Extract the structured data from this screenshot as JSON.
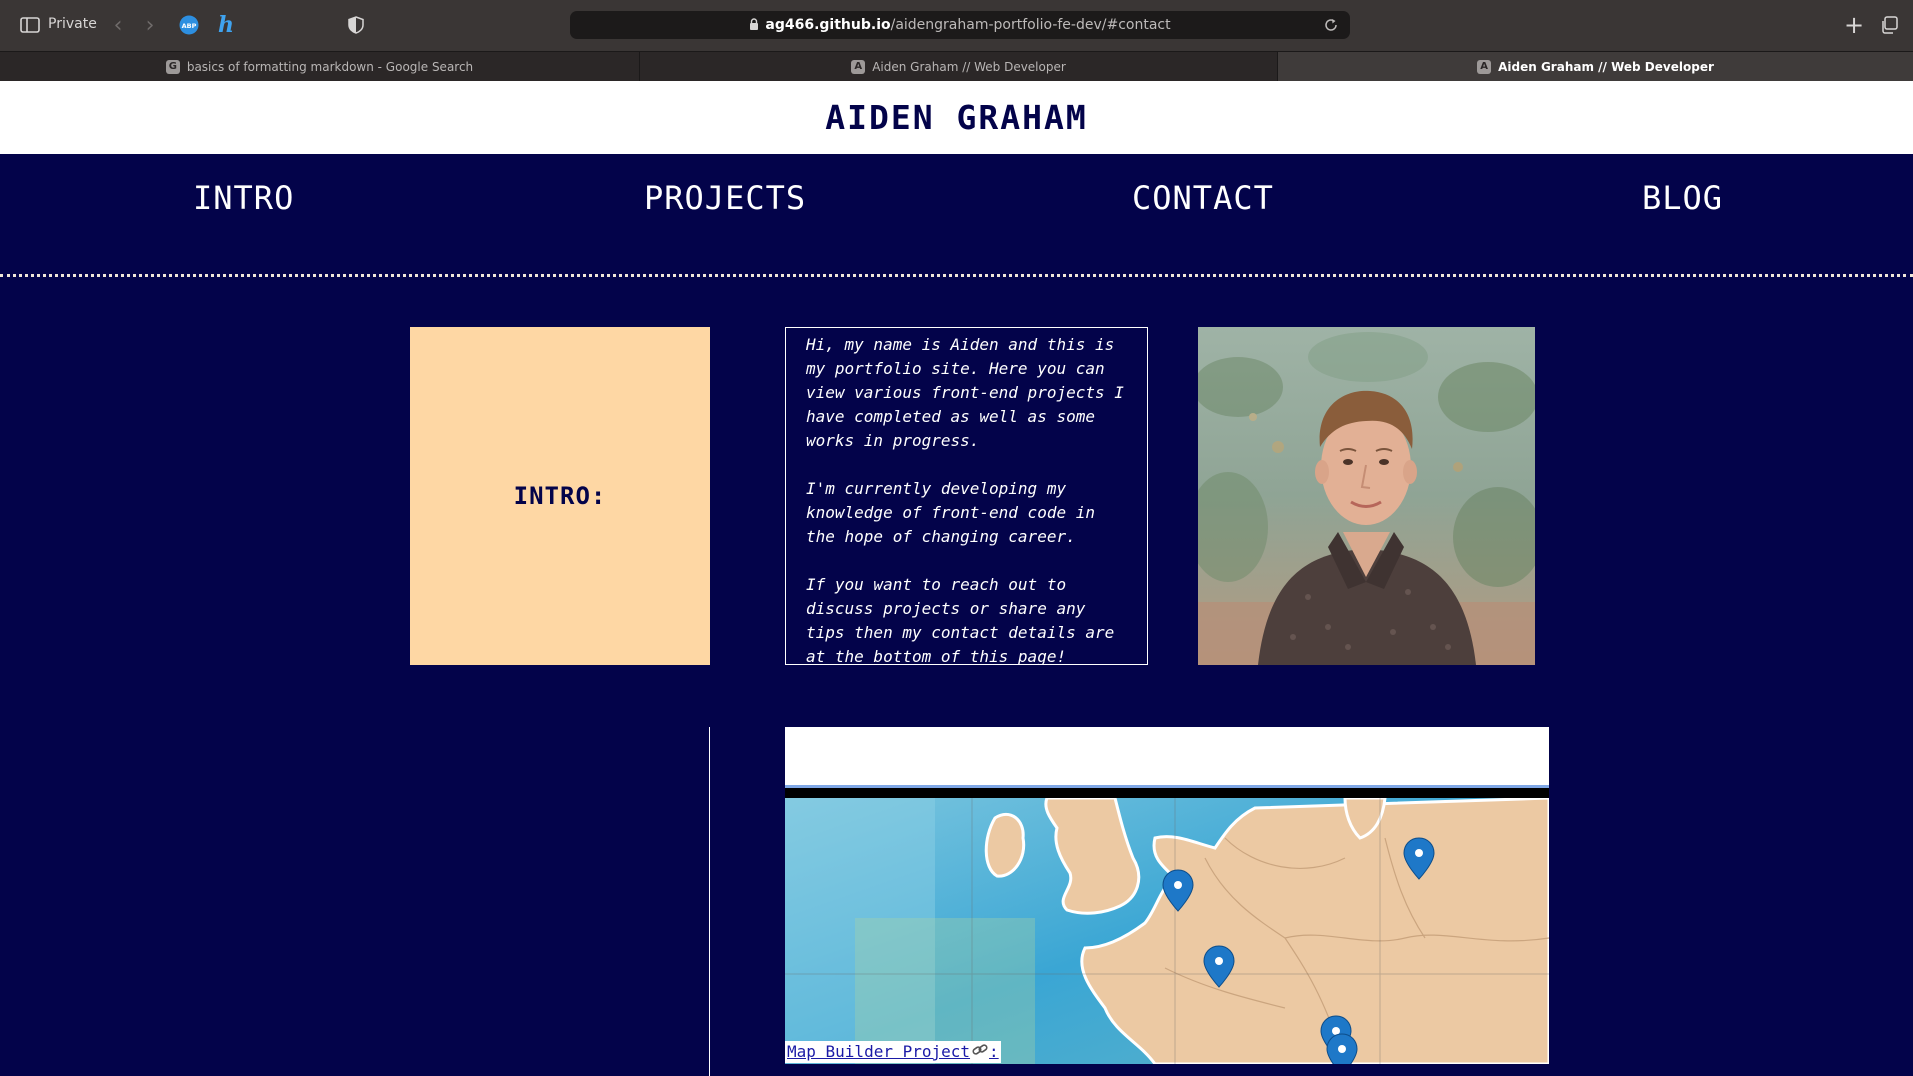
{
  "browser": {
    "private_label": "Private",
    "url_host": "ag466.github.io",
    "url_path": "/aidengraham-portfolio-fe-dev/#contact",
    "tabs": [
      {
        "favicon": "G",
        "title": "basics of formatting markdown - Google Search",
        "active": false
      },
      {
        "favicon": "A",
        "title": "Aiden Graham // Web Developer",
        "active": false
      },
      {
        "favicon": "A",
        "title": "Aiden Graham // Web Developer",
        "active": true
      }
    ],
    "icons": [
      "sidebar-icon",
      "back-arrow-icon",
      "forward-arrow-icon",
      "adblock-extension-icon",
      "honey-extension-icon",
      "shield-icon",
      "lock-icon",
      "reload-icon",
      "plus-icon",
      "tab-overview-icon"
    ]
  },
  "site": {
    "title": "AIDEN GRAHAM",
    "nav": [
      "INTRO",
      "PROJECTS",
      "CONTACT",
      "BLOG"
    ],
    "intro_heading": "INTRO:",
    "intro_paragraphs": [
      "Hi, my name is Aiden and this is my portfolio site. Here you can view various front-end projects I have completed as well as some works in progress.",
      "I'm currently developing my knowledge of front-end code in the hope of changing career.",
      "If you want to reach out to discuss projects or share any tips then my contact details are at the bottom of this page!"
    ],
    "project_link": "Map Builder Project",
    "project_link_suffix": ":"
  },
  "colors": {
    "page_bg": "#03034a",
    "intro_box": "#fed7a4",
    "header_bg": "#ffffff",
    "chrome_bg": "#3a3635",
    "link": "#1a1aa6",
    "map_pin": "#1e78c8"
  }
}
